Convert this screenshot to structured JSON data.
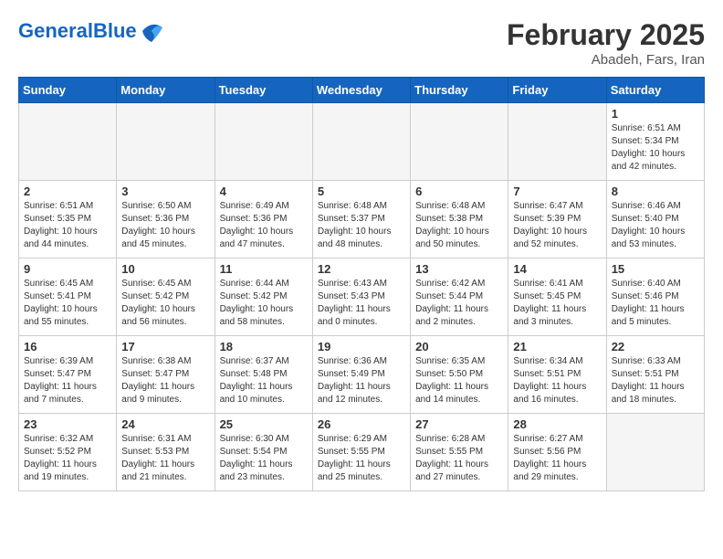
{
  "logo": {
    "general": "General",
    "blue": "Blue"
  },
  "title": "February 2025",
  "location": "Abadeh, Fars, Iran",
  "weekdays": [
    "Sunday",
    "Monday",
    "Tuesday",
    "Wednesday",
    "Thursday",
    "Friday",
    "Saturday"
  ],
  "weeks": [
    [
      {
        "day": "",
        "info": ""
      },
      {
        "day": "",
        "info": ""
      },
      {
        "day": "",
        "info": ""
      },
      {
        "day": "",
        "info": ""
      },
      {
        "day": "",
        "info": ""
      },
      {
        "day": "",
        "info": ""
      },
      {
        "day": "1",
        "info": "Sunrise: 6:51 AM\nSunset: 5:34 PM\nDaylight: 10 hours\nand 42 minutes."
      }
    ],
    [
      {
        "day": "2",
        "info": "Sunrise: 6:51 AM\nSunset: 5:35 PM\nDaylight: 10 hours\nand 44 minutes."
      },
      {
        "day": "3",
        "info": "Sunrise: 6:50 AM\nSunset: 5:36 PM\nDaylight: 10 hours\nand 45 minutes."
      },
      {
        "day": "4",
        "info": "Sunrise: 6:49 AM\nSunset: 5:36 PM\nDaylight: 10 hours\nand 47 minutes."
      },
      {
        "day": "5",
        "info": "Sunrise: 6:48 AM\nSunset: 5:37 PM\nDaylight: 10 hours\nand 48 minutes."
      },
      {
        "day": "6",
        "info": "Sunrise: 6:48 AM\nSunset: 5:38 PM\nDaylight: 10 hours\nand 50 minutes."
      },
      {
        "day": "7",
        "info": "Sunrise: 6:47 AM\nSunset: 5:39 PM\nDaylight: 10 hours\nand 52 minutes."
      },
      {
        "day": "8",
        "info": "Sunrise: 6:46 AM\nSunset: 5:40 PM\nDaylight: 10 hours\nand 53 minutes."
      }
    ],
    [
      {
        "day": "9",
        "info": "Sunrise: 6:45 AM\nSunset: 5:41 PM\nDaylight: 10 hours\nand 55 minutes."
      },
      {
        "day": "10",
        "info": "Sunrise: 6:45 AM\nSunset: 5:42 PM\nDaylight: 10 hours\nand 56 minutes."
      },
      {
        "day": "11",
        "info": "Sunrise: 6:44 AM\nSunset: 5:42 PM\nDaylight: 10 hours\nand 58 minutes."
      },
      {
        "day": "12",
        "info": "Sunrise: 6:43 AM\nSunset: 5:43 PM\nDaylight: 11 hours\nand 0 minutes."
      },
      {
        "day": "13",
        "info": "Sunrise: 6:42 AM\nSunset: 5:44 PM\nDaylight: 11 hours\nand 2 minutes."
      },
      {
        "day": "14",
        "info": "Sunrise: 6:41 AM\nSunset: 5:45 PM\nDaylight: 11 hours\nand 3 minutes."
      },
      {
        "day": "15",
        "info": "Sunrise: 6:40 AM\nSunset: 5:46 PM\nDaylight: 11 hours\nand 5 minutes."
      }
    ],
    [
      {
        "day": "16",
        "info": "Sunrise: 6:39 AM\nSunset: 5:47 PM\nDaylight: 11 hours\nand 7 minutes."
      },
      {
        "day": "17",
        "info": "Sunrise: 6:38 AM\nSunset: 5:47 PM\nDaylight: 11 hours\nand 9 minutes."
      },
      {
        "day": "18",
        "info": "Sunrise: 6:37 AM\nSunset: 5:48 PM\nDaylight: 11 hours\nand 10 minutes."
      },
      {
        "day": "19",
        "info": "Sunrise: 6:36 AM\nSunset: 5:49 PM\nDaylight: 11 hours\nand 12 minutes."
      },
      {
        "day": "20",
        "info": "Sunrise: 6:35 AM\nSunset: 5:50 PM\nDaylight: 11 hours\nand 14 minutes."
      },
      {
        "day": "21",
        "info": "Sunrise: 6:34 AM\nSunset: 5:51 PM\nDaylight: 11 hours\nand 16 minutes."
      },
      {
        "day": "22",
        "info": "Sunrise: 6:33 AM\nSunset: 5:51 PM\nDaylight: 11 hours\nand 18 minutes."
      }
    ],
    [
      {
        "day": "23",
        "info": "Sunrise: 6:32 AM\nSunset: 5:52 PM\nDaylight: 11 hours\nand 19 minutes."
      },
      {
        "day": "24",
        "info": "Sunrise: 6:31 AM\nSunset: 5:53 PM\nDaylight: 11 hours\nand 21 minutes."
      },
      {
        "day": "25",
        "info": "Sunrise: 6:30 AM\nSunset: 5:54 PM\nDaylight: 11 hours\nand 23 minutes."
      },
      {
        "day": "26",
        "info": "Sunrise: 6:29 AM\nSunset: 5:55 PM\nDaylight: 11 hours\nand 25 minutes."
      },
      {
        "day": "27",
        "info": "Sunrise: 6:28 AM\nSunset: 5:55 PM\nDaylight: 11 hours\nand 27 minutes."
      },
      {
        "day": "28",
        "info": "Sunrise: 6:27 AM\nSunset: 5:56 PM\nDaylight: 11 hours\nand 29 minutes."
      },
      {
        "day": "",
        "info": ""
      }
    ]
  ]
}
